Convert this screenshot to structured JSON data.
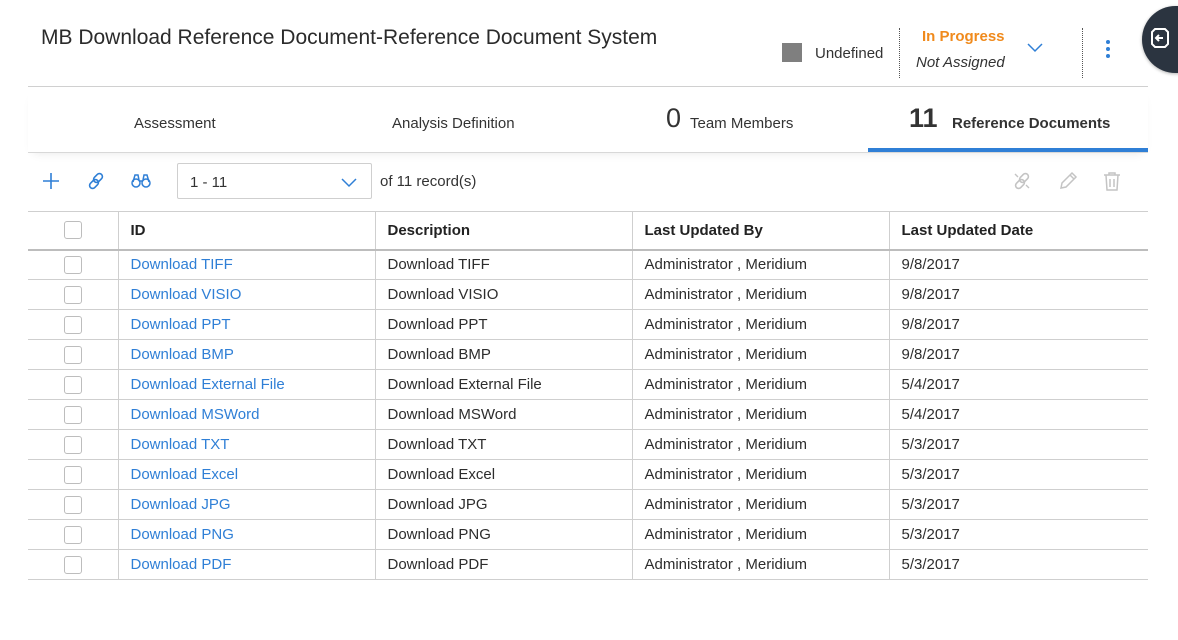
{
  "header": {
    "title": "MB Download Reference Document-Reference Document System",
    "status_label": "Undefined",
    "state": "In Progress",
    "assignment": "Not Assigned"
  },
  "tabs": [
    {
      "label": "Assessment",
      "count": ""
    },
    {
      "label": "Analysis Definition",
      "count": ""
    },
    {
      "label": "Team Members",
      "count": "0"
    },
    {
      "label": "Reference Documents",
      "count": "11",
      "active": true
    }
  ],
  "toolbar": {
    "icons": [
      "plus-icon",
      "link-icon",
      "binoculars-icon",
      "unlink-icon",
      "pencil-icon",
      "trash-icon"
    ],
    "range": "1 - 11",
    "of_text": "of 11 record(s)"
  },
  "table": {
    "columns": [
      "ID",
      "Description",
      "Last Updated By",
      "Last Updated Date"
    ],
    "rows": [
      [
        "Download TIFF",
        "Download TIFF",
        "Administrator , Meridium",
        "9/8/2017"
      ],
      [
        "Download VISIO",
        "Download VISIO",
        "Administrator , Meridium",
        "9/8/2017"
      ],
      [
        "Download PPT",
        "Download PPT",
        "Administrator , Meridium",
        "9/8/2017"
      ],
      [
        "Download BMP",
        "Download BMP",
        "Administrator , Meridium",
        "9/8/2017"
      ],
      [
        "Download External File",
        "Download External File",
        "Administrator , Meridium",
        "5/4/2017"
      ],
      [
        "Download MSWord",
        "Download MSWord",
        "Administrator , Meridium",
        "5/4/2017"
      ],
      [
        "Download TXT",
        "Download TXT",
        "Administrator , Meridium",
        "5/3/2017"
      ],
      [
        "Download Excel",
        "Download Excel",
        "Administrator , Meridium",
        "5/3/2017"
      ],
      [
        "Download JPG",
        "Download JPG",
        "Administrator , Meridium",
        "5/3/2017"
      ],
      [
        "Download PNG",
        "Download PNG",
        "Administrator , Meridium",
        "5/3/2017"
      ],
      [
        "Download PDF",
        "Download PDF",
        "Administrator , Meridium",
        "5/3/2017"
      ]
    ]
  },
  "colors": {
    "accent": "#2f7fd6",
    "state": "#f08a1c",
    "status_swatch": "#7f7f7f",
    "side_handle": "#2b3440"
  }
}
